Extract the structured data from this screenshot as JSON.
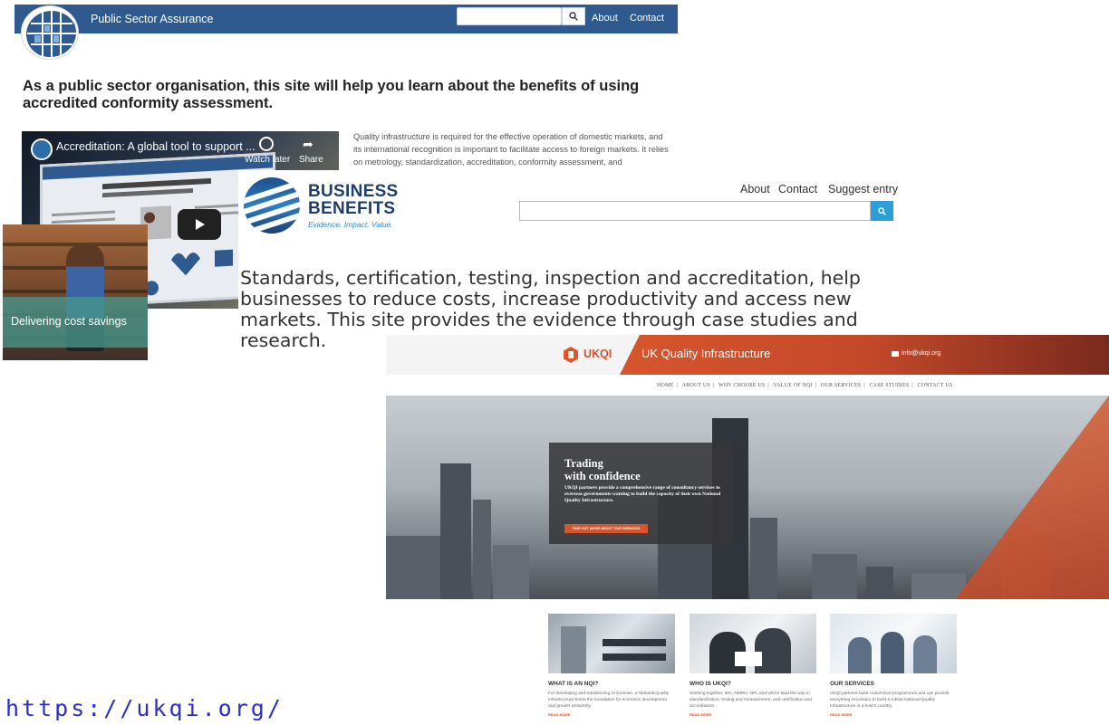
{
  "psa": {
    "site_title": "Public Sector Assurance",
    "nav": [
      "About",
      "Contact"
    ],
    "heading": "As a public sector organisation, this site will help you learn about the benefits of using accredited conformity assessment.",
    "intro_text": "Quality infrastructure is required for the effective operation of domestic markets, and its international recognition is important to facilitate access to foreign markets. It relies on metrology, standardization, accreditation, conformity assessment, and",
    "video": {
      "title": "Accreditation: A global tool to support ...",
      "watch_later": "Watch later",
      "share": "Share"
    }
  },
  "bb": {
    "logo_line1": "BUSINESS",
    "logo_line2": "BENEFITS",
    "tagline": "Evidence. Impact. Value.",
    "nav": [
      "About",
      "Contact",
      "Suggest entry"
    ],
    "description": "Standards, certification, testing, inspection and accreditation, help businesses to reduce costs, increase productivity and access new markets. This site provides the evidence through case studies and research.",
    "card_label": "Delivering cost savings"
  },
  "ukqi": {
    "logo_text": "UKQI",
    "title": "UK Quality Infrastructure",
    "email": "info@ukqi.org",
    "nav": [
      "HOME",
      "ABOUT US",
      "WHY CHOOSE US",
      "VALUE OF NQI",
      "OUR SERVICES",
      "CASE STUDIES",
      "CONTACT US"
    ],
    "hero": {
      "title_line1": "Trading",
      "title_line2": "with confidence",
      "text": "UKQI partners provide a comprehensive range of consultancy services to overseas governments wanting to build the capacity of their own National Quality Infrastructure.",
      "button": "FIND OUT MORE ABOUT OUR SERVICES"
    },
    "columns": [
      {
        "title": "WHAT IS AN NQI?",
        "text": "For developing and transitioning economies, a National Quality Infrastructure forms the foundation for economic development and greater prosperity.",
        "more": "READ MORE"
      },
      {
        "title": "WHO IS UKQI?",
        "text": "Working together, BSI, NMRO, NPL and UKAS lead the way in standardization, testing and measurement, and certification and accreditation.",
        "more": "READ MORE"
      },
      {
        "title": "OUR SERVICES",
        "text": "UKQI partners build customized programmes and can provide everything necessary to build a robust National Quality Infrastructure in a host's country.",
        "more": "READ MORE"
      }
    ]
  },
  "url_fragment": "https://ukqi.org/"
}
